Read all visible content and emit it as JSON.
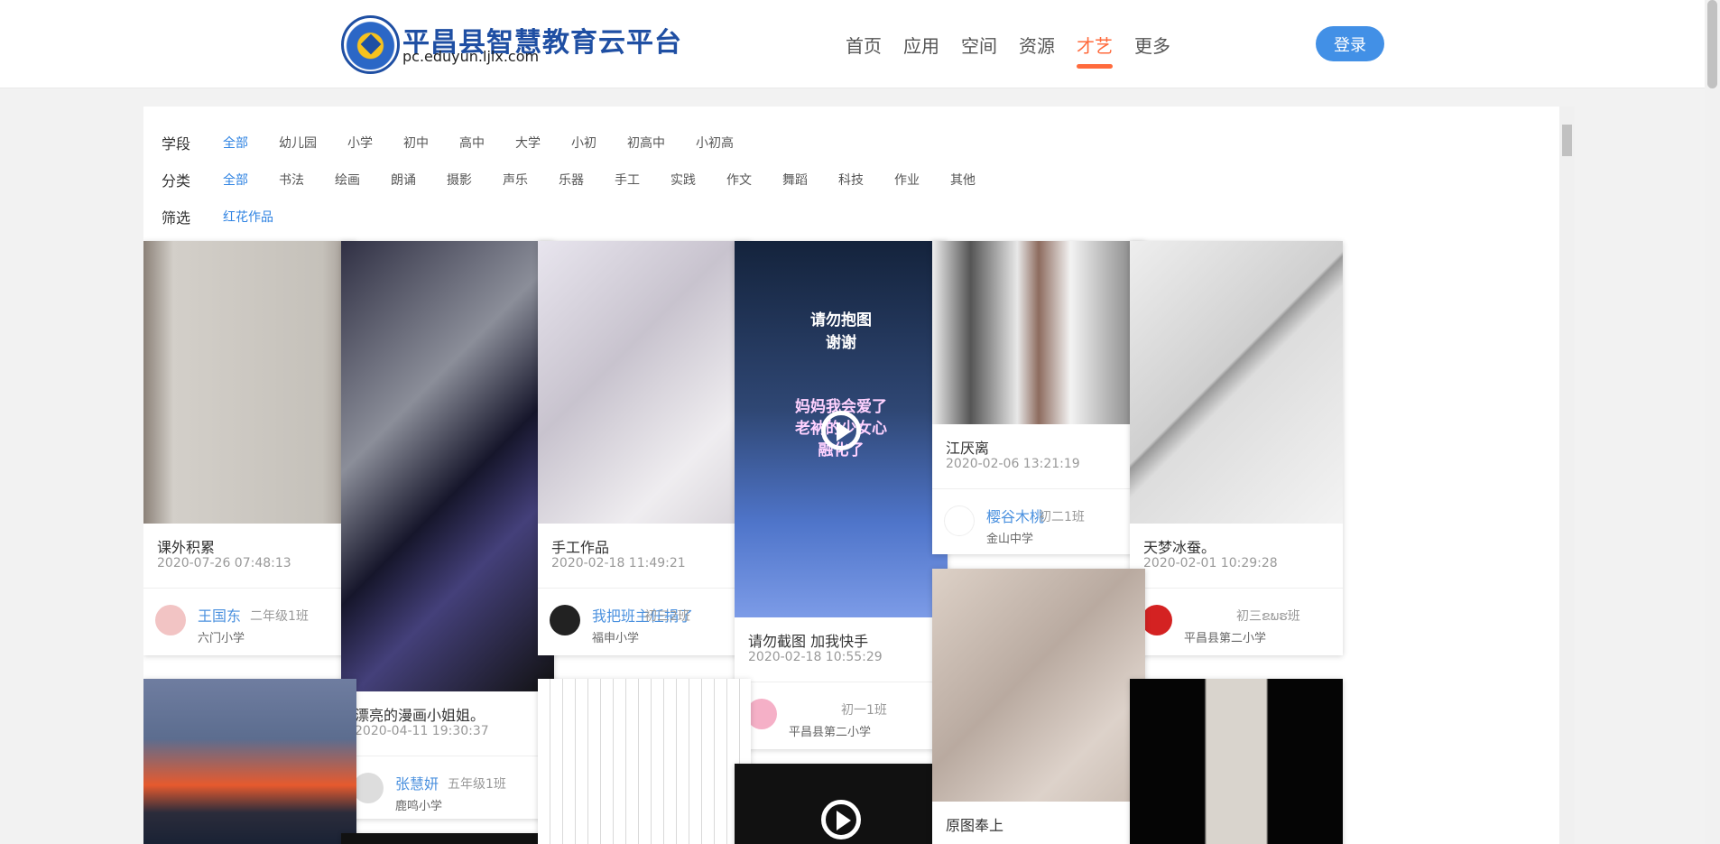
{
  "header": {
    "brand": "平昌县智慧教育云平台",
    "url": "pc.eduyun.ljlx.com",
    "nav": [
      "首页",
      "应用",
      "空间",
      "资源",
      "才艺",
      "更多"
    ],
    "login": "登录",
    "active_color": "#ff6b3d",
    "login_color": "#4290e6"
  },
  "filters": {
    "stage_label": "学段",
    "stage_options": [
      "全部",
      "幼儿园",
      "小学",
      "初中",
      "高中",
      "大学",
      "小初",
      "初高中",
      "小初高"
    ],
    "category_label": "分类",
    "category_options": [
      "全部",
      "书法",
      "绘画",
      "朗诵",
      "摄影",
      "声乐",
      "乐器",
      "手工",
      "实践",
      "作文",
      "舞蹈",
      "科技",
      "作业",
      "其他"
    ],
    "filter_label": "筛选",
    "filter_options": [
      "红花作品"
    ]
  },
  "cards": [
    {
      "title": "课外积累",
      "date": "2020-07-26 07:48:13",
      "name": "王国东",
      "class": "二年级1班",
      "school": "六门小学"
    },
    {
      "title": "漂亮的漫画小姐姐。",
      "date": "2020-04-11 19:30:37",
      "name": "张慧妍",
      "class": "五年级1班",
      "school": "鹿鸣小学"
    },
    {
      "title": "手工作品",
      "date": "2020-02-18 11:49:21",
      "name": "我把班主任捐了",
      "class": "初三2班",
      "school": "福申小学"
    },
    {
      "title": "请勿截图 加我快手",
      "date": "2020-02-18 10:55:29",
      "name": "",
      "class": "初一1班",
      "school": "平昌县第二小学"
    },
    {
      "title": "江厌离",
      "date": "2020-02-06 13:21:19",
      "name": "樱谷木桃",
      "class": "初二1班",
      "school": "金山中学"
    },
    {
      "title": "天梦冰蚕。",
      "date": "2020-02-01 10:29:28",
      "name": "",
      "class": "初三ຂພຮ班",
      "school": "平昌县第二小学"
    },
    {
      "title": "原图奉上",
      "date": "",
      "name": "",
      "class": "",
      "school": ""
    }
  ],
  "image_text": {
    "video_line1": "请勿抱图",
    "video_line2": "谢谢",
    "video_line3": "妈妈我会爱了",
    "video_line4": "老衲的少女心",
    "video_line5": "融化了"
  }
}
